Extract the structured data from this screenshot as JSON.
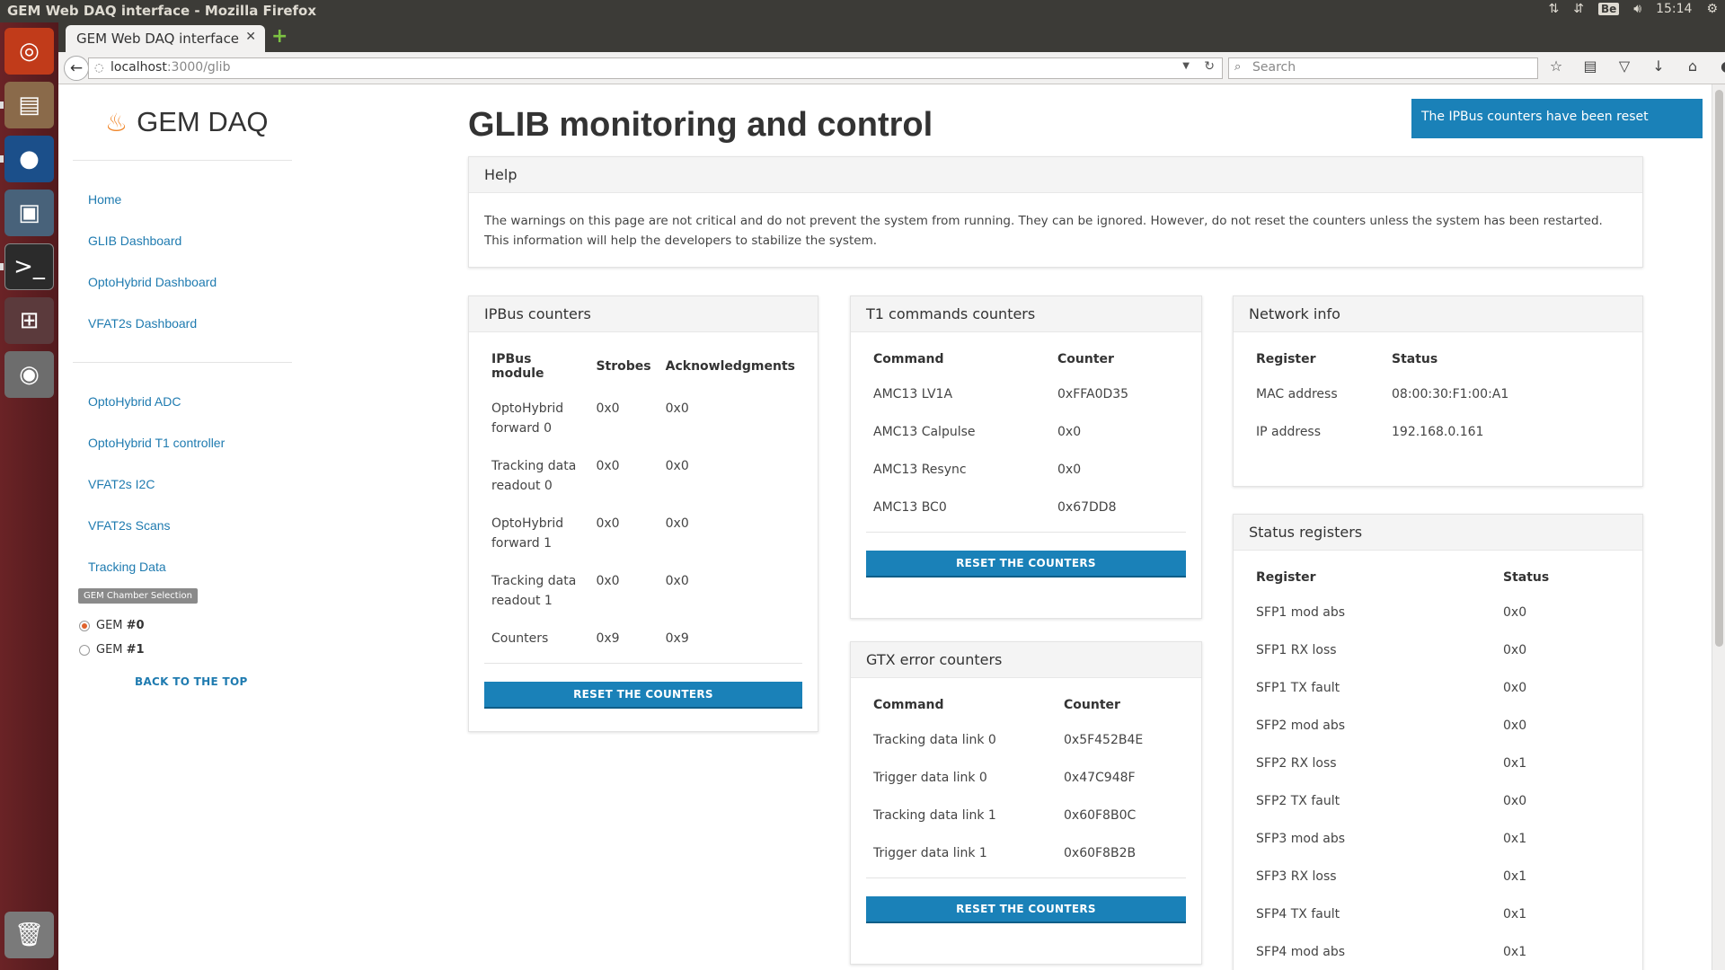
{
  "os": {
    "window_title": "GEM Web DAQ interface - Mozilla Firefox",
    "keyboard_layout": "Be",
    "clock": "15:14"
  },
  "browser": {
    "tab_title": "GEM Web DAQ interface",
    "url_host": "localhost",
    "url_rest": ":3000/glib",
    "search_placeholder": "Search"
  },
  "sidebar": {
    "brand": "GEM DAQ",
    "nav_primary": [
      "Home",
      "GLIB Dashboard",
      "OptoHybrid Dashboard",
      "VFAT2s Dashboard"
    ],
    "nav_secondary": [
      "OptoHybrid ADC",
      "OptoHybrid T1 controller",
      "VFAT2s I2C",
      "VFAT2s Scans",
      "Tracking Data"
    ],
    "chamber_chip": "GEM Chamber Selection",
    "gem_label": "GEM",
    "chambers": [
      "#0",
      "#1"
    ],
    "selected_chamber": 0,
    "back_to_top": "BACK TO THE TOP"
  },
  "main": {
    "title": "GLIB monitoring and control",
    "notice": "The IPBus counters have been reset",
    "help": {
      "title": "Help",
      "text": "The warnings on this page are not critical and do not prevent the system from running. They can be ignored. However, do not reset the counters unless the system has been restarted. This information will help the developers to stabilize the system."
    },
    "ipbus": {
      "title": "IPBus counters",
      "headers": [
        "IPBus module",
        "Strobes",
        "Acknowledgments"
      ],
      "rows": [
        [
          "OptoHybrid forward 0",
          "0x0",
          "0x0"
        ],
        [
          "Tracking data readout 0",
          "0x0",
          "0x0"
        ],
        [
          "OptoHybrid forward 1",
          "0x0",
          "0x0"
        ],
        [
          "Tracking data readout 1",
          "0x0",
          "0x0"
        ],
        [
          "Counters",
          "0x9",
          "0x9"
        ]
      ],
      "button": "RESET THE COUNTERS"
    },
    "t1": {
      "title": "T1 commands counters",
      "headers": [
        "Command",
        "Counter"
      ],
      "rows": [
        [
          "AMC13 LV1A",
          "0xFFA0D35"
        ],
        [
          "AMC13 Calpulse",
          "0x0"
        ],
        [
          "AMC13 Resync",
          "0x0"
        ],
        [
          "AMC13 BC0",
          "0x67DD8"
        ]
      ],
      "button": "RESET THE COUNTERS"
    },
    "gtx": {
      "title": "GTX error counters",
      "headers": [
        "Command",
        "Counter"
      ],
      "rows": [
        [
          "Tracking data link 0",
          "0x5F452B4E"
        ],
        [
          "Trigger data link 0",
          "0x47C948F"
        ],
        [
          "Tracking data link 1",
          "0x60F8B0C"
        ],
        [
          "Trigger data link 1",
          "0x60F8B2B"
        ]
      ],
      "button": "RESET THE COUNTERS"
    },
    "network": {
      "title": "Network info",
      "headers": [
        "Register",
        "Status"
      ],
      "rows": [
        [
          "MAC address",
          "08:00:30:F1:00:A1"
        ],
        [
          "IP address",
          "192.168.0.161"
        ]
      ]
    },
    "status": {
      "title": "Status registers",
      "headers": [
        "Register",
        "Status"
      ],
      "rows": [
        [
          "SFP1 mod abs",
          "0x0"
        ],
        [
          "SFP1 RX loss",
          "0x0"
        ],
        [
          "SFP1 TX fault",
          "0x0"
        ],
        [
          "SFP2 mod abs",
          "0x0"
        ],
        [
          "SFP2 RX loss",
          "0x1"
        ],
        [
          "SFP2 TX fault",
          "0x0"
        ],
        [
          "SFP3 mod abs",
          "0x1"
        ],
        [
          "SFP3 RX loss",
          "0x1"
        ],
        [
          "SFP4 TX fault",
          "0x1"
        ],
        [
          "SFP4 mod abs",
          "0x1"
        ]
      ]
    }
  }
}
